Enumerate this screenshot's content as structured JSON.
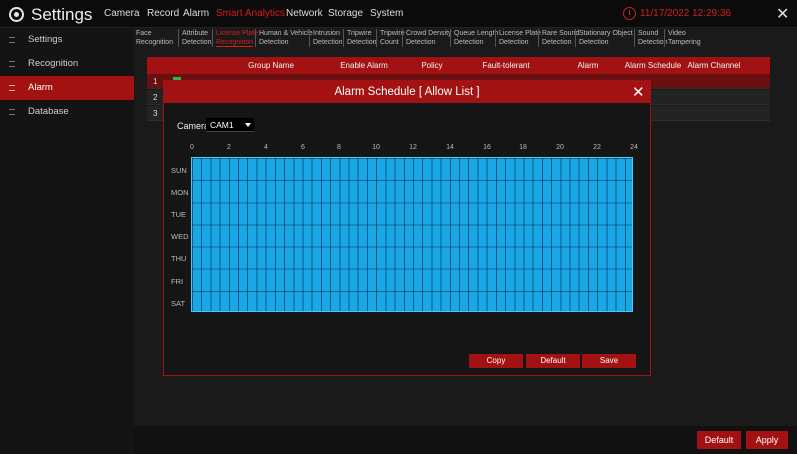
{
  "header": {
    "title": "Settings",
    "menu": [
      "Camera",
      "Record",
      "Alarm",
      "Smart Analytics",
      "Network",
      "Storage",
      "System"
    ],
    "active_menu": "Smart Analytics",
    "clock": "11/17/2022 12:29:36"
  },
  "sidebar": {
    "items": [
      {
        "label": "Settings"
      },
      {
        "label": "Recognition"
      },
      {
        "label": "Alarm"
      },
      {
        "label": "Database"
      }
    ],
    "active": "Alarm"
  },
  "subtabs": [
    {
      "line1": "Face",
      "line2": "Recognition"
    },
    {
      "line1": "Attribute",
      "line2": "Detection"
    },
    {
      "line1": "License Plate",
      "line2": "Recognition"
    },
    {
      "line1": "Human & Vehicle",
      "line2": "Detection"
    },
    {
      "line1": "Intrusion",
      "line2": "Detection"
    },
    {
      "line1": "Tripwire",
      "line2": "Detection"
    },
    {
      "line1": "Tripwire",
      "line2": "Count"
    },
    {
      "line1": "Crowd Density",
      "line2": "Detection"
    },
    {
      "line1": "Queue Length",
      "line2": "Detection"
    },
    {
      "line1": "License Plate",
      "line2": "Detection"
    },
    {
      "line1": "Rare Sound",
      "line2": "Detection"
    },
    {
      "line1": "Stationary Object",
      "line2": "Detection"
    },
    {
      "line1": "Sound",
      "line2": "Detection"
    },
    {
      "line1": "Video",
      "line2": "Tampering"
    }
  ],
  "table": {
    "headers": [
      "Group Name",
      "Enable Alarm",
      "Policy",
      "Fault-tolerant",
      "Alarm",
      "Alarm Schedule",
      "Alarm Channel"
    ],
    "rows": [
      {
        "num": "1"
      },
      {
        "num": "2"
      },
      {
        "num": "3"
      }
    ]
  },
  "dialog": {
    "title": "Alarm Schedule [ Allow List ]",
    "camera_label": "Camera",
    "camera_value": "CAM1",
    "hours": [
      "0",
      "2",
      "4",
      "6",
      "8",
      "10",
      "12",
      "14",
      "16",
      "18",
      "20",
      "22",
      "24"
    ],
    "days": [
      "SUN",
      "MON",
      "TUE",
      "WED",
      "THU",
      "FRI",
      "SAT"
    ],
    "schedule_color": "#1aa7e6",
    "buttons": {
      "copy": "Copy",
      "default": "Default",
      "save": "Save"
    }
  },
  "footer": {
    "default": "Default",
    "apply": "Apply"
  },
  "colors": {
    "accent": "#a31212",
    "active_text": "#d71e1e",
    "schedule": "#1aa7e6"
  },
  "icons": {
    "logo": "gear-icon",
    "clock": "clock-icon",
    "close": "close-icon",
    "dropdown": "chevron-down-icon"
  }
}
